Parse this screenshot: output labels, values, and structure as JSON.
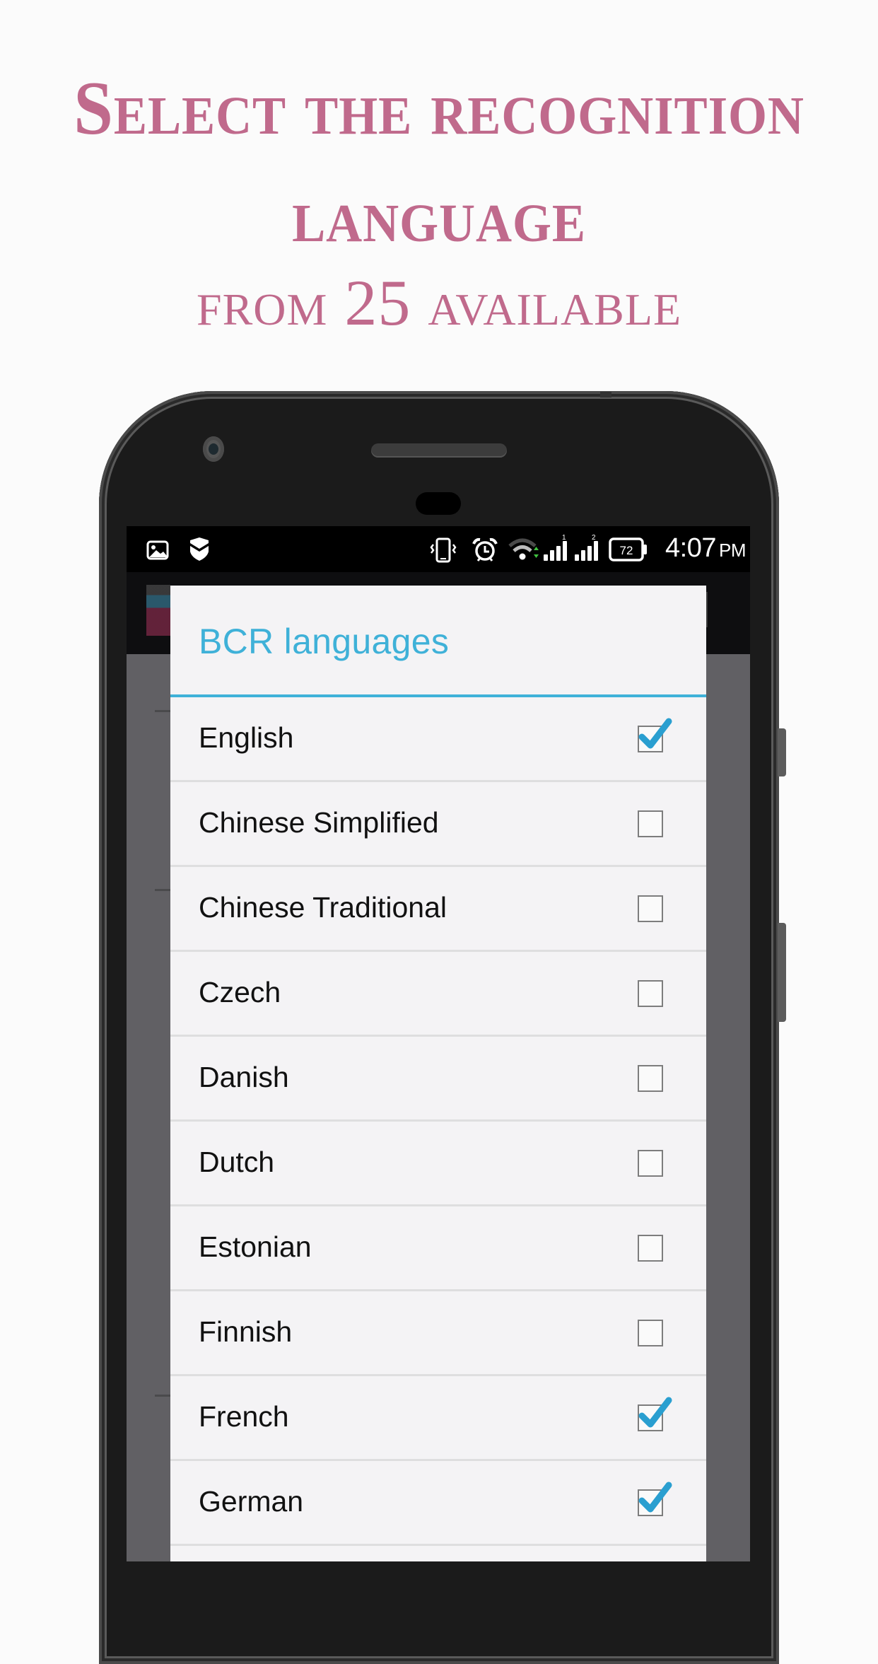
{
  "headline": {
    "line1": "Select the recognition",
    "line2": "language",
    "line3_prefix": "from ",
    "line3_number": "25",
    "line3_suffix": " available"
  },
  "statusbar": {
    "left_icons": [
      "image-icon",
      "shield-icon"
    ],
    "right_icons": [
      "vibrate-icon",
      "alarm-icon",
      "wifi-icon",
      "signal-sim1-icon",
      "signal-sim2-icon",
      "battery-icon"
    ],
    "sim1_label": "1",
    "sim2_label": "2",
    "battery_level": "72",
    "time": "4:07",
    "ampm": "PM"
  },
  "dialog": {
    "title": "BCR languages",
    "accent_color": "#3fb1d8",
    "languages": [
      {
        "label": "English",
        "checked": true
      },
      {
        "label": "Chinese Simplified",
        "checked": false
      },
      {
        "label": "Chinese Traditional",
        "checked": false
      },
      {
        "label": "Czech",
        "checked": false
      },
      {
        "label": "Danish",
        "checked": false
      },
      {
        "label": "Dutch",
        "checked": false
      },
      {
        "label": "Estonian",
        "checked": false
      },
      {
        "label": "Finnish",
        "checked": false
      },
      {
        "label": "French",
        "checked": true
      },
      {
        "label": "German",
        "checked": true
      }
    ]
  },
  "colors": {
    "headline": "#c06a8c",
    "check": "#2a9fd0"
  }
}
